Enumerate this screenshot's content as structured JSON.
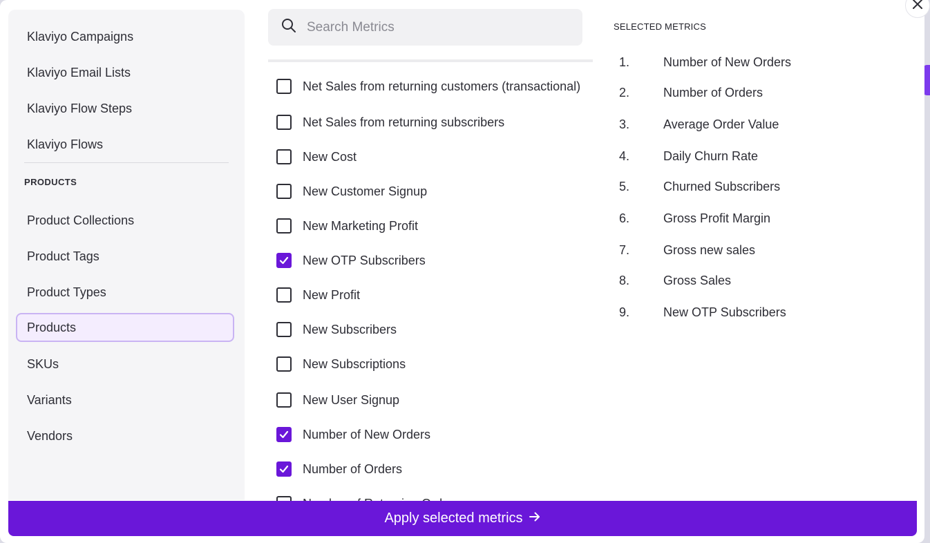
{
  "sidebar": {
    "items_top": [
      "Klaviyo Campaigns",
      "Klaviyo Email Lists",
      "Klaviyo Flow Steps",
      "Klaviyo Flows"
    ],
    "section_label": "PRODUCTS",
    "product_items": [
      "Product Collections",
      "Product Tags",
      "Product Types",
      "Products",
      "SKUs",
      "Variants",
      "Vendors"
    ],
    "active_item": "Products"
  },
  "search": {
    "placeholder": "Search Metrics",
    "value": ""
  },
  "metrics": [
    {
      "label": "Net Sales from returning customers (transactional)",
      "checked": false
    },
    {
      "label": "Net Sales from returning subscribers",
      "checked": false
    },
    {
      "label": "New Cost",
      "checked": false
    },
    {
      "label": "New Customer Signup",
      "checked": false
    },
    {
      "label": "New Marketing Profit",
      "checked": false
    },
    {
      "label": "New OTP Subscribers",
      "checked": true
    },
    {
      "label": "New Profit",
      "checked": false
    },
    {
      "label": "New Subscribers",
      "checked": false
    },
    {
      "label": "New Subscriptions",
      "checked": false
    },
    {
      "label": "New User Signup",
      "checked": false
    },
    {
      "label": "Number of New Orders",
      "checked": true
    },
    {
      "label": "Number of Orders",
      "checked": true
    },
    {
      "label": "Number of Returning Orders",
      "checked": false
    }
  ],
  "selected": {
    "title": "SELECTED METRICS",
    "items": [
      {
        "num": "1.",
        "label": "Number of New Orders"
      },
      {
        "num": "2.",
        "label": "Number of Orders"
      },
      {
        "num": "3.",
        "label": "Average Order Value"
      },
      {
        "num": "4.",
        "label": "Daily Churn Rate"
      },
      {
        "num": "5.",
        "label": "Churned Subscribers"
      },
      {
        "num": "6.",
        "label": "Gross Profit Margin"
      },
      {
        "num": "7.",
        "label": "Gross new sales"
      },
      {
        "num": "8.",
        "label": "Gross Sales"
      },
      {
        "num": "9.",
        "label": "New OTP Subscribers"
      }
    ]
  },
  "apply_button": {
    "label": "Apply selected metrics"
  },
  "colors": {
    "accent": "#6a17d9",
    "active_bg": "#f4edfe",
    "active_border": "#c9b4f3"
  }
}
